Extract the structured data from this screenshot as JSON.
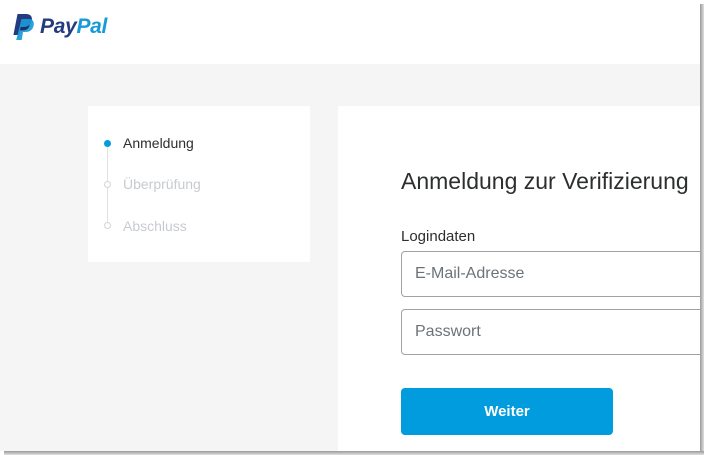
{
  "brand": {
    "name_part1": "Pay",
    "name_part2": "Pal",
    "logo_icon": "paypal-p-icon",
    "color_dark": "#253b80",
    "color_light": "#179bd7"
  },
  "steps": {
    "items": [
      {
        "label": "Anmeldung",
        "state": "active"
      },
      {
        "label": "Überprüfung",
        "state": "inactive"
      },
      {
        "label": "Abschluss",
        "state": "inactive"
      }
    ],
    "active_color": "#009cde"
  },
  "form": {
    "title": "Anmeldung zur Verifizierung",
    "section_label": "Logindaten",
    "email": {
      "placeholder": "E-Mail-Adresse",
      "value": ""
    },
    "password": {
      "placeholder": "Passwort",
      "value": ""
    },
    "submit_label": "Weiter",
    "button_color": "#009cde"
  }
}
